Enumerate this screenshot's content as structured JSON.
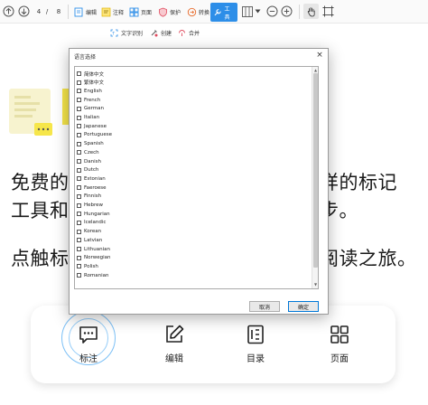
{
  "toolbar": {
    "page_current": "4",
    "page_sep": "/",
    "page_total": "8",
    "tools": [
      {
        "label": "编辑",
        "icon": "edit-icon"
      },
      {
        "label": "注释",
        "icon": "annotate-icon"
      },
      {
        "label": "页面",
        "icon": "page-icon"
      },
      {
        "label": "保护",
        "icon": "protect-icon"
      },
      {
        "label": "转换",
        "icon": "convert-icon"
      },
      {
        "label": "工具",
        "icon": "tools-icon"
      }
    ],
    "active_tool": "工具"
  },
  "subtoolbar": {
    "items": [
      {
        "label": "文字识别",
        "icon": "ocr-icon"
      },
      {
        "label": "创建",
        "icon": "create-icon"
      },
      {
        "label": "合并",
        "icon": "merge-icon"
      }
    ]
  },
  "background": {
    "line1_left": "免费的",
    "line1_right": "样的标记",
    "line2_left": "工具和",
    "line2_right": "步。",
    "line3_left": "点触标",
    "line3_right": "阅读之旅。"
  },
  "bottombar": {
    "items": [
      {
        "label": "标注",
        "icon": "comment-icon"
      },
      {
        "label": "编辑",
        "icon": "edit-pen-icon"
      },
      {
        "label": "目录",
        "icon": "toc-icon"
      },
      {
        "label": "页面",
        "icon": "grid-icon"
      }
    ]
  },
  "dialog": {
    "title": "语言选择",
    "close": "×",
    "languages": [
      "简体中文",
      "繁体中文",
      "English",
      "French",
      "German",
      "Italian",
      "Japanese",
      "Portuguese",
      "Spanish",
      "Czech",
      "Danish",
      "Dutch",
      "Estonian",
      "Faeroese",
      "Finnish",
      "Hebrew",
      "Hungarian",
      "Icelandic",
      "Korean",
      "Latvian",
      "Lithuanian",
      "Norwegian",
      "Polish",
      "Romanian"
    ],
    "cancel_label": "取消",
    "ok_label": "确定"
  },
  "colors": {
    "accent": "#2d8ee8",
    "ripple": "#7cc0f6",
    "illustration_yellow": "#f6e64a"
  }
}
